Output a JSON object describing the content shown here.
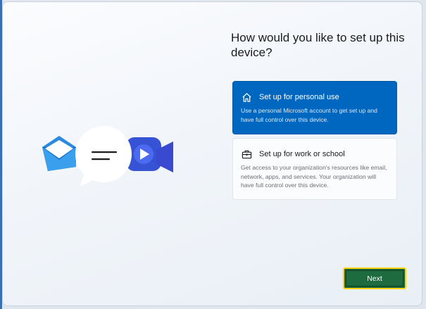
{
  "page": {
    "heading": "How would you like to set up this device?"
  },
  "options": [
    {
      "icon": "home-icon",
      "title": "Set up for personal use",
      "description": "Use a personal Microsoft account to get set up and have full control over this device.",
      "selected": true
    },
    {
      "icon": "briefcase-icon",
      "title": "Set up for work or school",
      "description": "Get access to your organization's resources like email, network, apps, and services. Your organization will have full control over this device.",
      "selected": false
    }
  ],
  "footer": {
    "next_label": "Next"
  },
  "illustration": {
    "icons": [
      "mail-icon",
      "chat-bubble-icon",
      "video-camera-icon"
    ]
  },
  "colors": {
    "accent": "#0067c0",
    "next_button": "#1d6b3e",
    "focus_outline": "#ffd400"
  }
}
